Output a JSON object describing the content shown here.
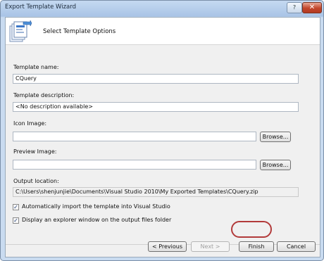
{
  "window": {
    "title": "Export Template Wizard",
    "help_label": "?",
    "close_label": "✕"
  },
  "header": {
    "title": "Select Template Options",
    "icon": "wizard-document-export-icon"
  },
  "form": {
    "template_name_label": "Template name:",
    "template_name_value": "CQuery",
    "template_description_label": "Template description:",
    "template_description_value": "<No description available>",
    "icon_image_label": "Icon Image:",
    "icon_image_value": "",
    "preview_image_label": "Preview Image:",
    "preview_image_value": "",
    "browse_label": "Browse...",
    "output_location_label": "Output location:",
    "output_location_value": "C:\\Users\\shenjunjie\\Documents\\Visual Studio 2010\\My Exported Templates\\CQuery.zip",
    "auto_import_label": "Automatically import the template into Visual Studio",
    "auto_import_checked": true,
    "display_explorer_label": "Display an explorer window on the output files folder",
    "display_explorer_checked": true
  },
  "buttons": {
    "previous": "< Previous",
    "next": "Next >",
    "finish": "Finish",
    "cancel": "Cancel"
  },
  "colors": {
    "titlebar": "#a9c4e6",
    "close_button": "#c2452a",
    "highlight_oval": "#b23a3a"
  }
}
